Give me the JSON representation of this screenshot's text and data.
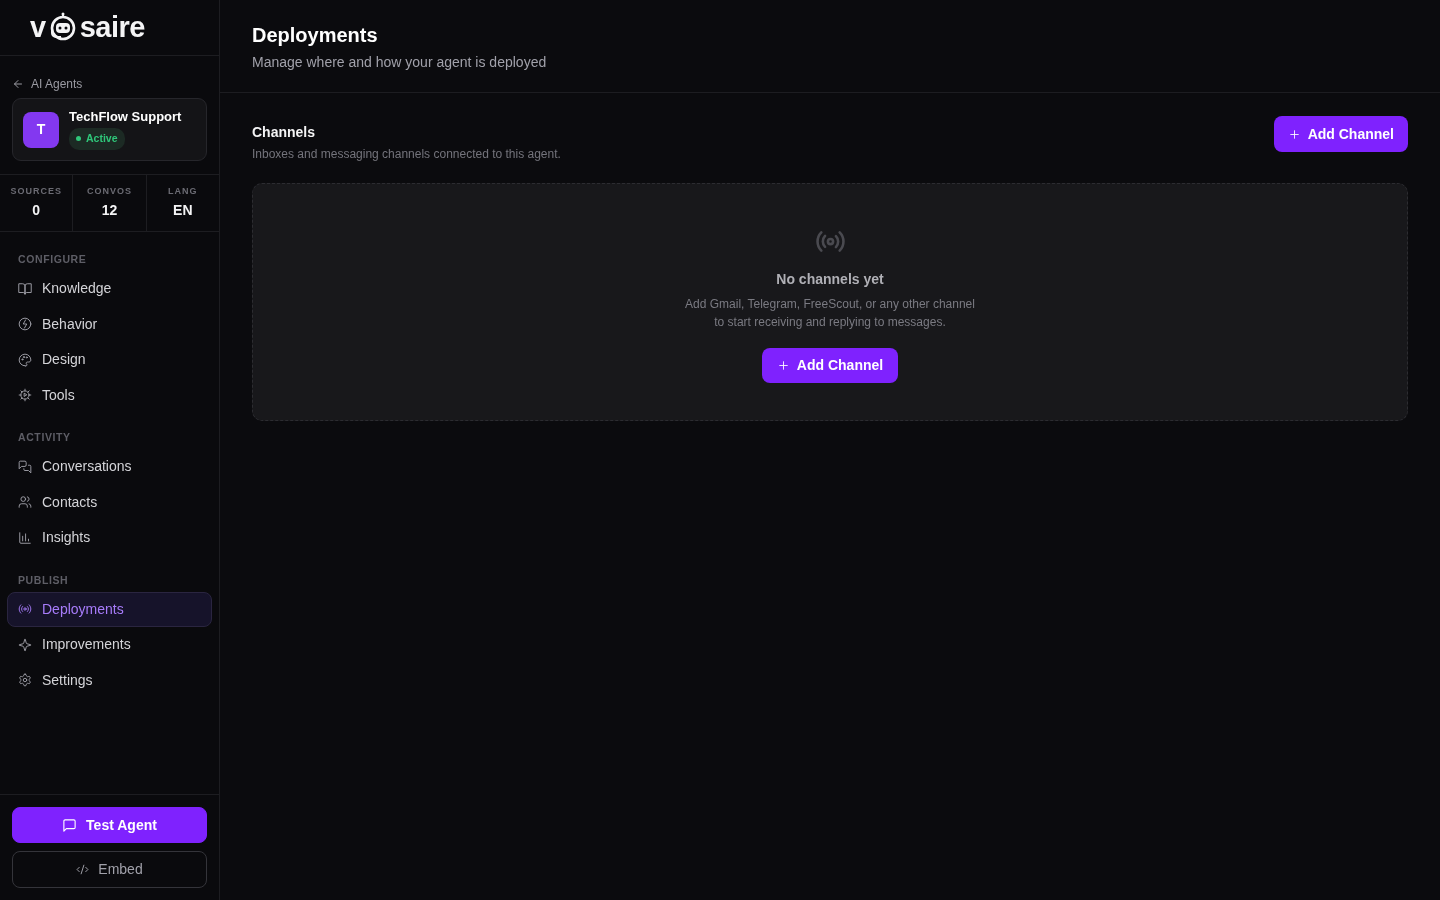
{
  "sidebar": {
    "logo": {
      "before": "v",
      "after": "saire"
    },
    "back_link": {
      "label": "AI Agents"
    },
    "agent": {
      "initial": "T",
      "name": "TechFlow Support",
      "status": "Active"
    },
    "stats": [
      {
        "label": "SOURCES",
        "value": "0"
      },
      {
        "label": "CONVOS",
        "value": "12"
      },
      {
        "label": "LANG",
        "value": "EN"
      }
    ],
    "sections": [
      {
        "heading": "CONFIGURE",
        "items": [
          {
            "label": "Knowledge",
            "selected": false
          },
          {
            "label": "Behavior",
            "selected": false
          },
          {
            "label": "Design",
            "selected": false
          },
          {
            "label": "Tools",
            "selected": false
          }
        ]
      },
      {
        "heading": "ACTIVITY",
        "items": [
          {
            "label": "Conversations",
            "selected": false
          },
          {
            "label": "Contacts",
            "selected": false
          },
          {
            "label": "Insights",
            "selected": false
          }
        ]
      },
      {
        "heading": "PUBLISH",
        "items": [
          {
            "label": "Deployments",
            "selected": true
          },
          {
            "label": "Improvements",
            "selected": false
          },
          {
            "label": "Settings",
            "selected": false
          }
        ]
      }
    ],
    "actions": [
      {
        "label": "Test Agent",
        "kind": "primary"
      },
      {
        "label": "Embed",
        "kind": "outline"
      }
    ]
  },
  "header": {
    "title": "Deployments",
    "subtitle": "Manage where and how your agent is deployed"
  },
  "channels": {
    "title": "Channels",
    "description": "Inboxes and messaging channels connected to this agent.",
    "add_button": "Add Channel",
    "empty_state": {
      "title": "No channels yet",
      "lines": [
        "Add Gmail, Telegram, FreeScout, or any other channel",
        "to start receiving and replying to messages."
      ],
      "button": "Add Channel"
    }
  }
}
